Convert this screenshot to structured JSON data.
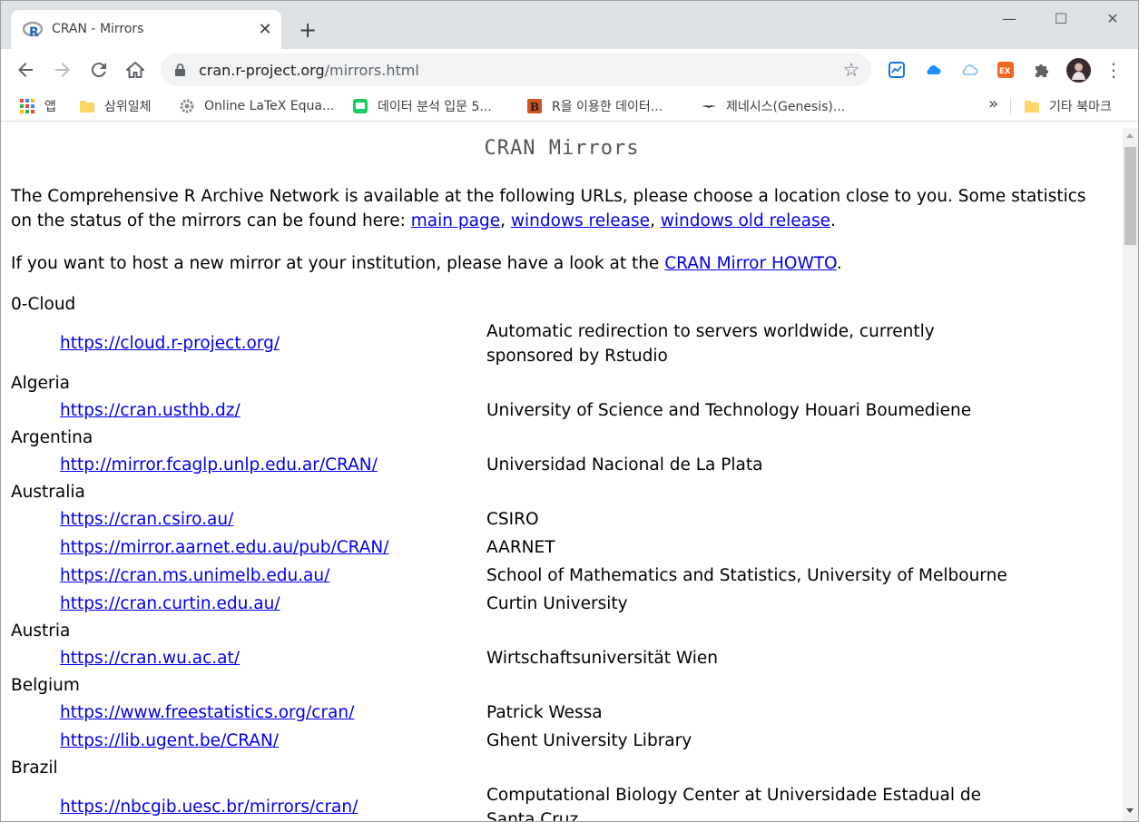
{
  "browser": {
    "tab": {
      "title": "CRAN - Mirrors",
      "close_glyph": "✕"
    },
    "new_tab_glyph": "+",
    "window_controls": {
      "minimize": "—",
      "maximize": "☐",
      "close": "✕"
    },
    "toolbar": {
      "url_host": "cran.r-project.org",
      "url_path": "/mirrors.html",
      "star_glyph": "☆",
      "menu_glyph": "⋮"
    },
    "bookmarks": [
      {
        "label": "앱",
        "icon": "apps-grid-icon"
      },
      {
        "label": "삼위일체",
        "icon": "folder-icon"
      },
      {
        "label": "Online LaTeX Equa...",
        "icon": "gear-icon"
      },
      {
        "label": "데이터 분석 입문 5...",
        "icon": "chat-icon"
      },
      {
        "label": "R을 이용한 데이터...",
        "icon": "book-icon"
      },
      {
        "label": "제네시스(Genesis)...",
        "icon": "genesis-logo-icon"
      }
    ],
    "bookmarks_more": "»",
    "other_bookmarks": "기타 북마크"
  },
  "page": {
    "title": "CRAN Mirrors",
    "intro_text_1": "The Comprehensive R Archive Network is available at the following URLs, please choose a location close to you. Some statistics on the status of the mirrors can be found here: ",
    "intro_link_main": "main page",
    "intro_sep_1": ", ",
    "intro_link_windows": "windows release",
    "intro_sep_2": ", ",
    "intro_link_windows_old": "windows old release",
    "intro_end": ".",
    "host_text": "If you want to host a new mirror at your institution, please have a look at the ",
    "host_link": "CRAN Mirror HOWTO",
    "host_end": ".",
    "mirrors": [
      {
        "country": "0-Cloud",
        "entries": [
          {
            "url": "https://cloud.r-project.org/",
            "desc": "Automatic redirection to servers worldwide, currently sponsored by Rstudio"
          }
        ]
      },
      {
        "country": "Algeria",
        "entries": [
          {
            "url": "https://cran.usthb.dz/",
            "desc": "University of Science and Technology Houari Boumediene"
          }
        ]
      },
      {
        "country": "Argentina",
        "entries": [
          {
            "url": "http://mirror.fcaglp.unlp.edu.ar/CRAN/",
            "desc": "Universidad Nacional de La Plata"
          }
        ]
      },
      {
        "country": "Australia",
        "entries": [
          {
            "url": "https://cran.csiro.au/",
            "desc": "CSIRO"
          },
          {
            "url": "https://mirror.aarnet.edu.au/pub/CRAN/",
            "desc": "AARNET"
          },
          {
            "url": "https://cran.ms.unimelb.edu.au/",
            "desc": "School of Mathematics and Statistics, University of Melbourne"
          },
          {
            "url": "https://cran.curtin.edu.au/",
            "desc": "Curtin University"
          }
        ]
      },
      {
        "country": "Austria",
        "entries": [
          {
            "url": "https://cran.wu.ac.at/",
            "desc": "Wirtschaftsuniversität Wien"
          }
        ]
      },
      {
        "country": "Belgium",
        "entries": [
          {
            "url": "https://www.freestatistics.org/cran/",
            "desc": "Patrick Wessa"
          },
          {
            "url": "https://lib.ugent.be/CRAN/",
            "desc": "Ghent University Library"
          }
        ]
      },
      {
        "country": "Brazil",
        "entries": [
          {
            "url": "https://nbcgib.uesc.br/mirrors/cran/",
            "desc": "Computational Biology Center at Universidade Estadual de Santa Cruz"
          }
        ]
      }
    ]
  }
}
